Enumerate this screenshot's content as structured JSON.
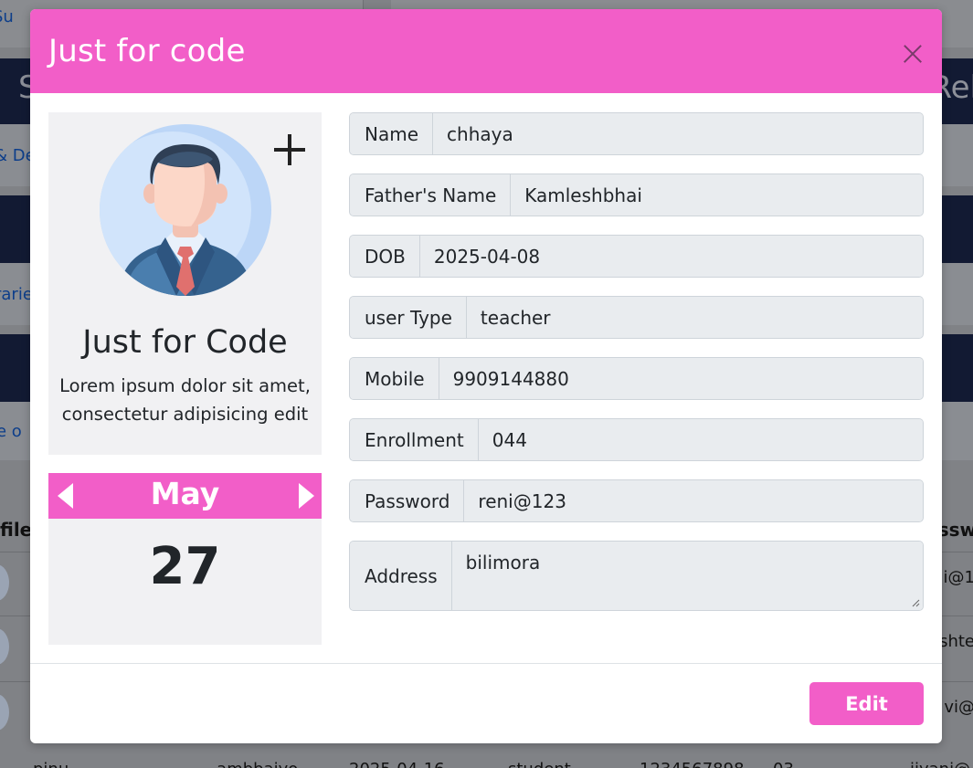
{
  "background": {
    "top_link": "Su",
    "heading_left": "S",
    "heading_right": "Rel",
    "link_2": "& De",
    "link_3": "rarie",
    "link_4": "e o",
    "table_head_left": "file",
    "table_head_right": "ssw",
    "row_values": [
      "ni@1",
      "shte",
      "vi@"
    ],
    "bottom_row": [
      "pinu...",
      "...ambbaiyo",
      "2025-04-16",
      "student",
      "1234567898",
      "03",
      "jiyani@"
    ]
  },
  "modal": {
    "title": "Just for code",
    "close_label": "Close"
  },
  "profile": {
    "name": "Just for Code",
    "description": "Lorem ipsum dolor sit amet, consectetur adipisicing edit"
  },
  "calendar": {
    "month": "May",
    "day": "27"
  },
  "form": {
    "name_label": "Name",
    "name_value": "chhaya",
    "father_label": "Father's Name",
    "father_value": "Kamleshbhai",
    "dob_label": "DOB",
    "dob_value": "2025-04-08",
    "user_type_label": "user Type",
    "user_type_value": "teacher",
    "mobile_label": "Mobile",
    "mobile_value": "9909144880",
    "enrollment_label": "Enrollment",
    "enrollment_value": "044",
    "password_label": "Password",
    "password_value": "reni@123",
    "address_label": "Address",
    "address_value": "bilimora"
  },
  "footer": {
    "edit_label": "Edit"
  },
  "colors": {
    "accent": "#f25ec8",
    "field_bg": "#e9ecef",
    "card_bg": "#f1f1f3",
    "backdrop": "#808286"
  },
  "icons": {
    "close": "close-icon",
    "add": "plus-icon",
    "prev": "arrow-left-icon",
    "next": "arrow-right-icon",
    "avatar": "businessman-avatar-icon"
  }
}
